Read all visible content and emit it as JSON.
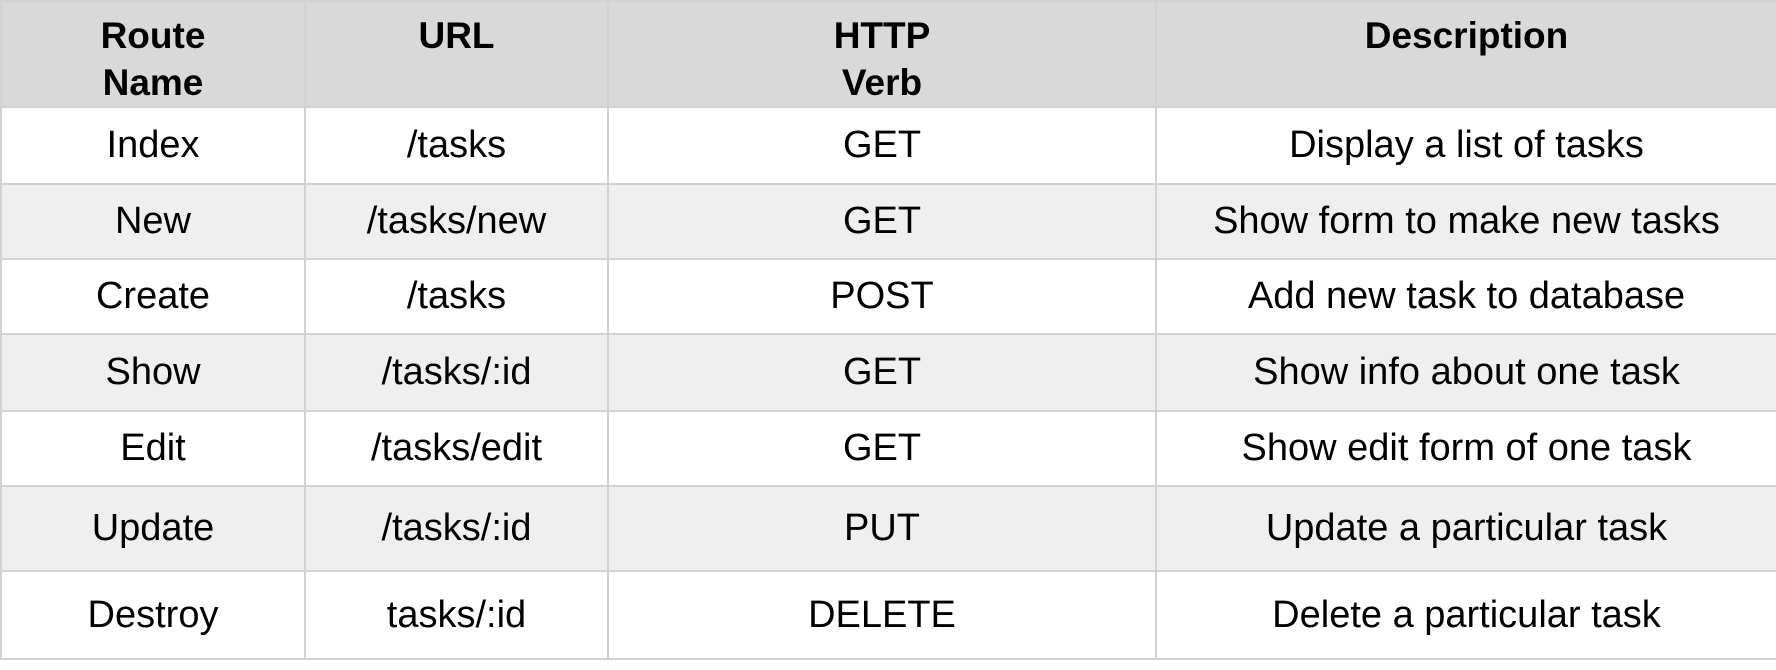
{
  "table": {
    "headers": {
      "route_name": [
        "Route",
        "Name"
      ],
      "url": [
        "URL"
      ],
      "http_verb": [
        "HTTP",
        "Verb"
      ],
      "description": [
        "Description"
      ]
    },
    "rows": [
      {
        "route": "Index",
        "url": "/tasks",
        "verb": "GET",
        "description": "Display a list of tasks"
      },
      {
        "route": "New",
        "url": "/tasks/new",
        "verb": "GET",
        "description": "Show form to make new tasks"
      },
      {
        "route": "Create",
        "url": "/tasks",
        "verb": "POST",
        "description": "Add new task to database"
      },
      {
        "route": "Show",
        "url": "/tasks/:id",
        "verb": "GET",
        "description": "Show info about one task"
      },
      {
        "route": "Edit",
        "url": "/tasks/edit",
        "verb": "GET",
        "description": "Show edit form of one task"
      },
      {
        "route": "Update",
        "url": "/tasks/:id",
        "verb": "PUT",
        "description": "Update a particular task"
      },
      {
        "route": "Destroy",
        "url": "tasks/:id",
        "verb": "DELETE",
        "description": "Delete a particular task"
      }
    ]
  },
  "colors": {
    "header_bg": "#d9d9d9",
    "row_alt_bg": "#efefef",
    "row_bg": "#ffffff",
    "grid_line": "#d2d2d2"
  }
}
